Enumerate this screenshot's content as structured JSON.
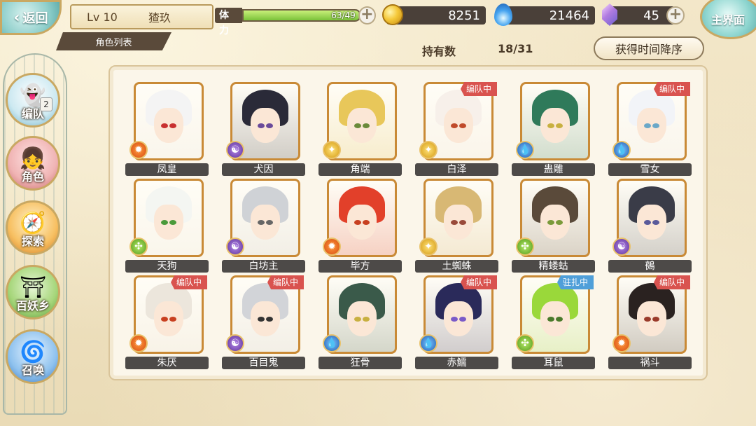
{
  "header": {
    "back_label": "返回",
    "level": "Lv 10",
    "player_name": "猹玖",
    "list_title": "角色列表",
    "main_label": "主界面"
  },
  "stamina": {
    "label": "体力",
    "text": "63/49",
    "fill_fraction": 1.0
  },
  "currencies": [
    {
      "icon": "gold-coin-icon",
      "value": "8251"
    },
    {
      "icon": "blue-flame-icon",
      "value": "21464"
    },
    {
      "icon": "gem-icon",
      "value": "45"
    }
  ],
  "holdings": {
    "label": "持有数",
    "count": "18/31"
  },
  "sort_label": "获得时间降序",
  "nav": [
    {
      "label": "编队",
      "icon": "team-icon",
      "badge": "2"
    },
    {
      "label": "角色",
      "icon": "character-icon"
    },
    {
      "label": "探索",
      "icon": "explore-icon"
    },
    {
      "label": "百妖乡",
      "icon": "village-icon"
    },
    {
      "label": "召唤",
      "icon": "summon-icon"
    }
  ],
  "characters": [
    {
      "name": "凤皇",
      "element": "fire",
      "status": "",
      "hair": "#f4f4f4",
      "eye": "#c83030"
    },
    {
      "name": "犬因",
      "element": "yin",
      "status": "",
      "hair": "#2a2a38",
      "eye": "#6a4a9a"
    },
    {
      "name": "角端",
      "element": "sun",
      "status": "",
      "hair": "#e8c75a",
      "eye": "#6a8a3a"
    },
    {
      "name": "白泽",
      "element": "sun",
      "status": "编队中",
      "hair": "#f7f0ea",
      "eye": "#c04a2a"
    },
    {
      "name": "蛊雕",
      "element": "water",
      "status": "",
      "hair": "#2f7a5a",
      "eye": "#c8b040"
    },
    {
      "name": "雪女",
      "element": "water",
      "status": "编队中",
      "hair": "#f2f4f8",
      "eye": "#6aa8c8"
    },
    {
      "name": "天狗",
      "element": "wind",
      "status": "",
      "hair": "#f4f6f2",
      "eye": "#4a9a3a"
    },
    {
      "name": "白坊主",
      "element": "yin",
      "status": "",
      "hair": "#cfd2d6",
      "eye": "#666"
    },
    {
      "name": "毕方",
      "element": "fire",
      "status": "",
      "hair": "#e2402a",
      "eye": "#c84020"
    },
    {
      "name": "土蜘蛛",
      "element": "sun",
      "status": "",
      "hair": "#d8b874",
      "eye": "#9a4a3a"
    },
    {
      "name": "精蝼蛄",
      "element": "wind",
      "status": "",
      "hair": "#5a4a3a",
      "eye": "#7a9a3a"
    },
    {
      "name": "鵺",
      "element": "yin",
      "status": "",
      "hair": "#3a3c48",
      "eye": "#5a5a9a"
    },
    {
      "name": "朱厌",
      "element": "fire",
      "status": "编队中",
      "hair": "#ece6dc",
      "eye": "#c84020"
    },
    {
      "name": "百目鬼",
      "element": "yin",
      "status": "编队中",
      "hair": "#d2d4d8",
      "eye": "#333"
    },
    {
      "name": "狂骨",
      "element": "water",
      "status": "",
      "hair": "#3a5a4a",
      "eye": "#c8b040"
    },
    {
      "name": "赤鱬",
      "element": "water",
      "status": "编队中",
      "hair": "#2a2a5a",
      "eye": "#7a5ac8"
    },
    {
      "name": "耳鼠",
      "element": "wind",
      "status": "驻扎中",
      "hair": "#9ad83a",
      "eye": "#4a7a2a"
    },
    {
      "name": "祸斗",
      "element": "fire",
      "status": "编队中",
      "hair": "#2a2220",
      "eye": "#9a3a2a"
    }
  ]
}
